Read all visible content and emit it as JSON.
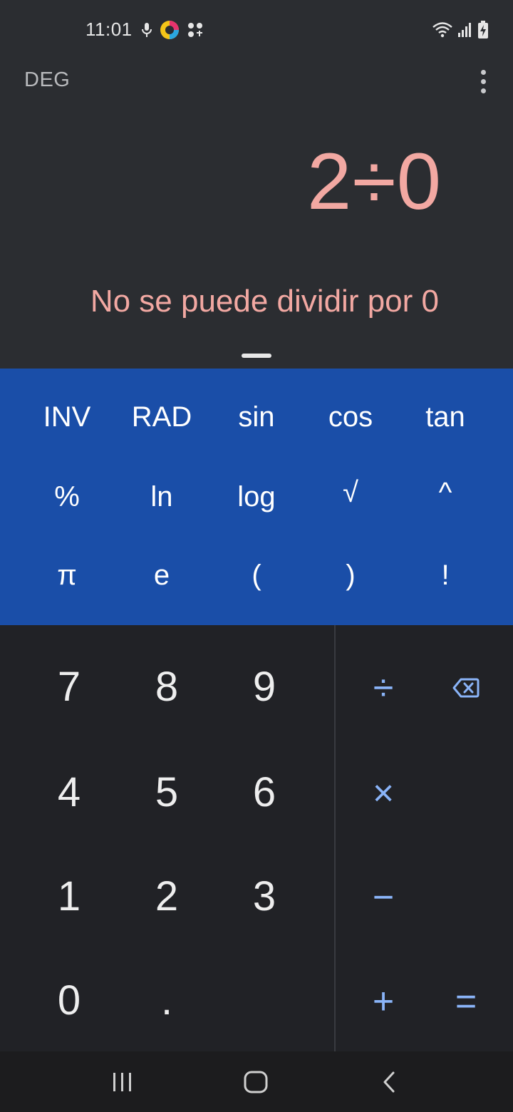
{
  "status_bar": {
    "time": "11:01",
    "left_icons": [
      "mic-icon",
      "colorful-app-icon",
      "dots-app-icon"
    ],
    "right_icons": [
      "wifi-icon",
      "signal-icon",
      "battery-charging-icon"
    ]
  },
  "toolbar": {
    "angle_mode": "DEG",
    "more_icon": "more-vert-icon"
  },
  "display": {
    "expression": "2÷0",
    "error": "No se puede dividir por 0"
  },
  "scientific_keys": [
    [
      "INV",
      "RAD",
      "sin",
      "cos",
      "tan"
    ],
    [
      "%",
      "ln",
      "log",
      "√",
      "^"
    ],
    [
      "π",
      "e",
      "(",
      ")",
      "!"
    ]
  ],
  "number_keys": [
    [
      "7",
      "8",
      "9"
    ],
    [
      "4",
      "5",
      "6"
    ],
    [
      "1",
      "2",
      "3"
    ],
    [
      "0",
      "."
    ]
  ],
  "operator_keys": {
    "divide": "÷",
    "backspace_icon": "backspace-icon",
    "multiply": "×",
    "minus": "−",
    "plus": "+",
    "equals": "="
  },
  "colors": {
    "background": "#2b2d31",
    "scientific_panel": "#1a4ea8",
    "numpad": "#212226",
    "accent": "#8ab4f8",
    "error": "#f2a8a2"
  },
  "nav_bar": {
    "icons": [
      "recent-apps-icon",
      "home-icon",
      "back-icon"
    ]
  }
}
